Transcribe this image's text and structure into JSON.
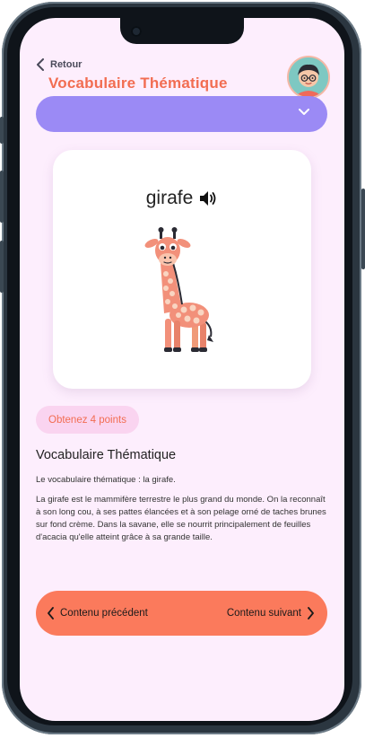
{
  "header": {
    "back_label": "Retour",
    "title": "Vocabulaire Thématique"
  },
  "card": {
    "word": "girafe"
  },
  "badge": {
    "points_label": "Obtenez 4 points"
  },
  "content": {
    "title": "Vocabulaire Thématique",
    "intro": "Le vocabulaire thématique : la girafe.",
    "paragraph": "La girafe est le mammifère terrestre le plus grand du monde. On la reconnaît à son long cou, à ses pattes élancées et à son pelage orné de taches brunes sur fond crème. Dans la savane, elle se nourrit principalement de feuilles d'acacia qu'elle atteint grâce à sa grande taille."
  },
  "navigation": {
    "prev_label": "Contenu précédent",
    "next_label": "Contenu suivant"
  },
  "colors": {
    "screen_bg": "#fdeefd",
    "title_orange": "#f26d52",
    "dropdown_purple": "#9b8af5",
    "badge_pink": "#fad4f0",
    "nav_orange": "#fb7a5c"
  },
  "icons": [
    "chevron-left-icon",
    "chevron-down-icon",
    "speaker-icon",
    "chevron-right-icon"
  ]
}
